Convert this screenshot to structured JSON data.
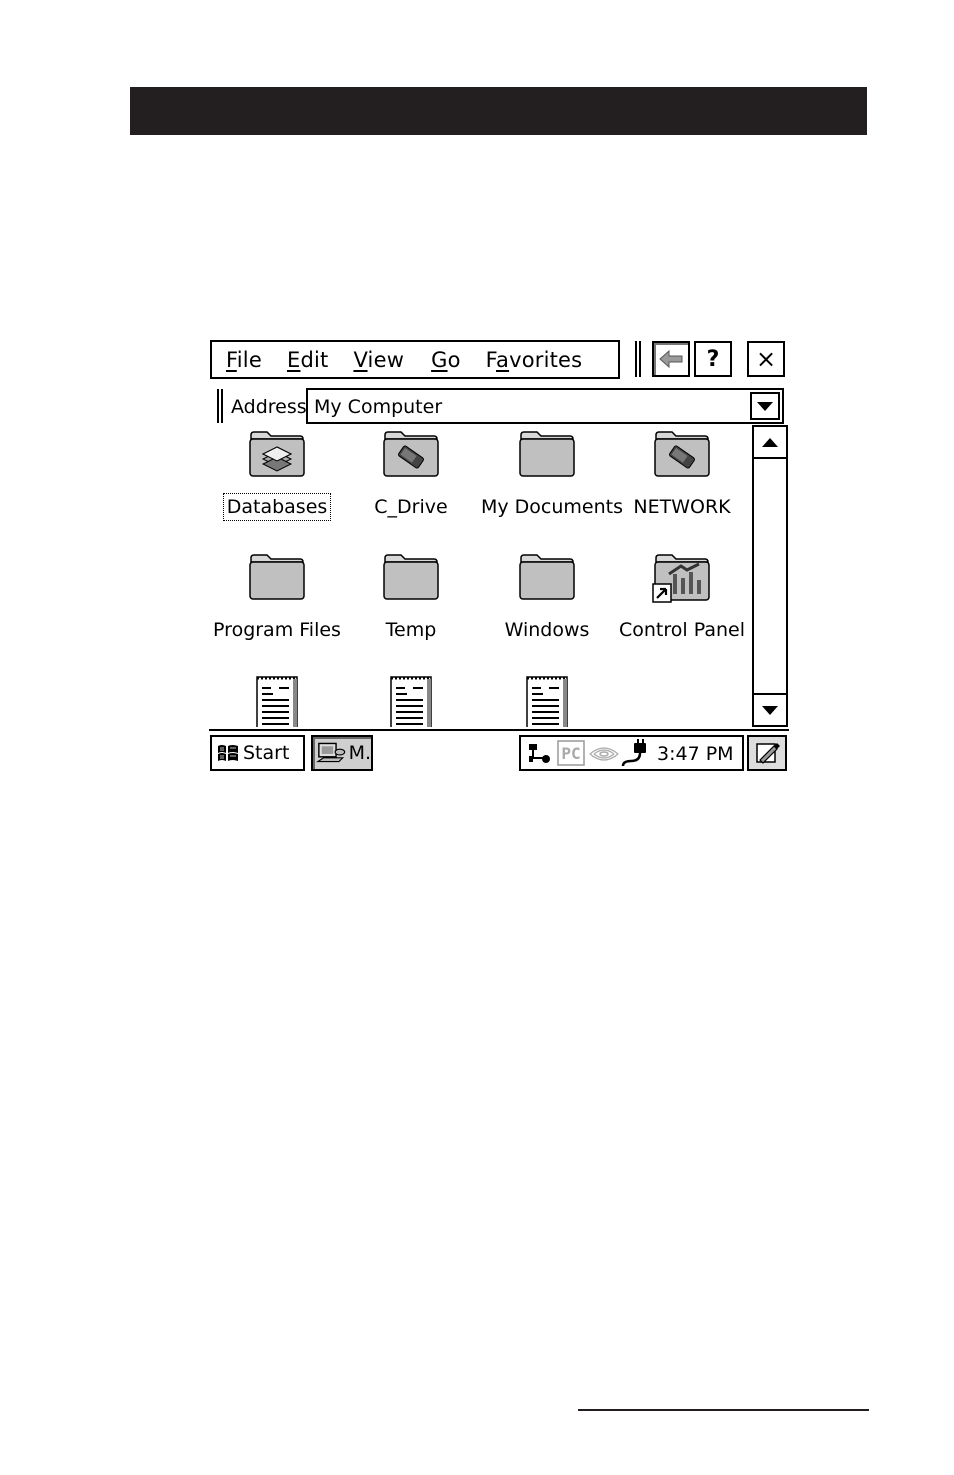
{
  "menubar": {
    "items": [
      {
        "pre": "",
        "key": "F",
        "post": "ile"
      },
      {
        "pre": "",
        "key": "E",
        "post": "dit"
      },
      {
        "pre": "",
        "key": "V",
        "post": "iew"
      },
      {
        "pre": "",
        "key": "G",
        "post": "o"
      },
      {
        "pre": "F",
        "key": "a",
        "post": "vorites"
      }
    ],
    "help_label": "?",
    "close_label": "×"
  },
  "address": {
    "label": "Address",
    "value": "My Computer"
  },
  "items": [
    {
      "label": "Databases",
      "icon": "database-folder-icon"
    },
    {
      "label": "C_Drive",
      "icon": "drive-folder-icon"
    },
    {
      "label": "My Documents",
      "icon": "folder-icon"
    },
    {
      "label": "NETWORK",
      "icon": "drive-folder-icon"
    },
    {
      "label": "Program Files",
      "icon": "folder-icon"
    },
    {
      "label": "Temp",
      "icon": "folder-icon"
    },
    {
      "label": "Windows",
      "icon": "folder-icon"
    },
    {
      "label": "Control Panel",
      "icon": "control-panel-shortcut-icon"
    }
  ],
  "taskbar": {
    "start_label": "Start",
    "task_label": "M.",
    "tray_pc_label": "PC",
    "clock": "3:47 PM"
  },
  "colors": {
    "banner": "#231f20",
    "folder_fill": "#c0c0c0",
    "outline": "#000000"
  }
}
